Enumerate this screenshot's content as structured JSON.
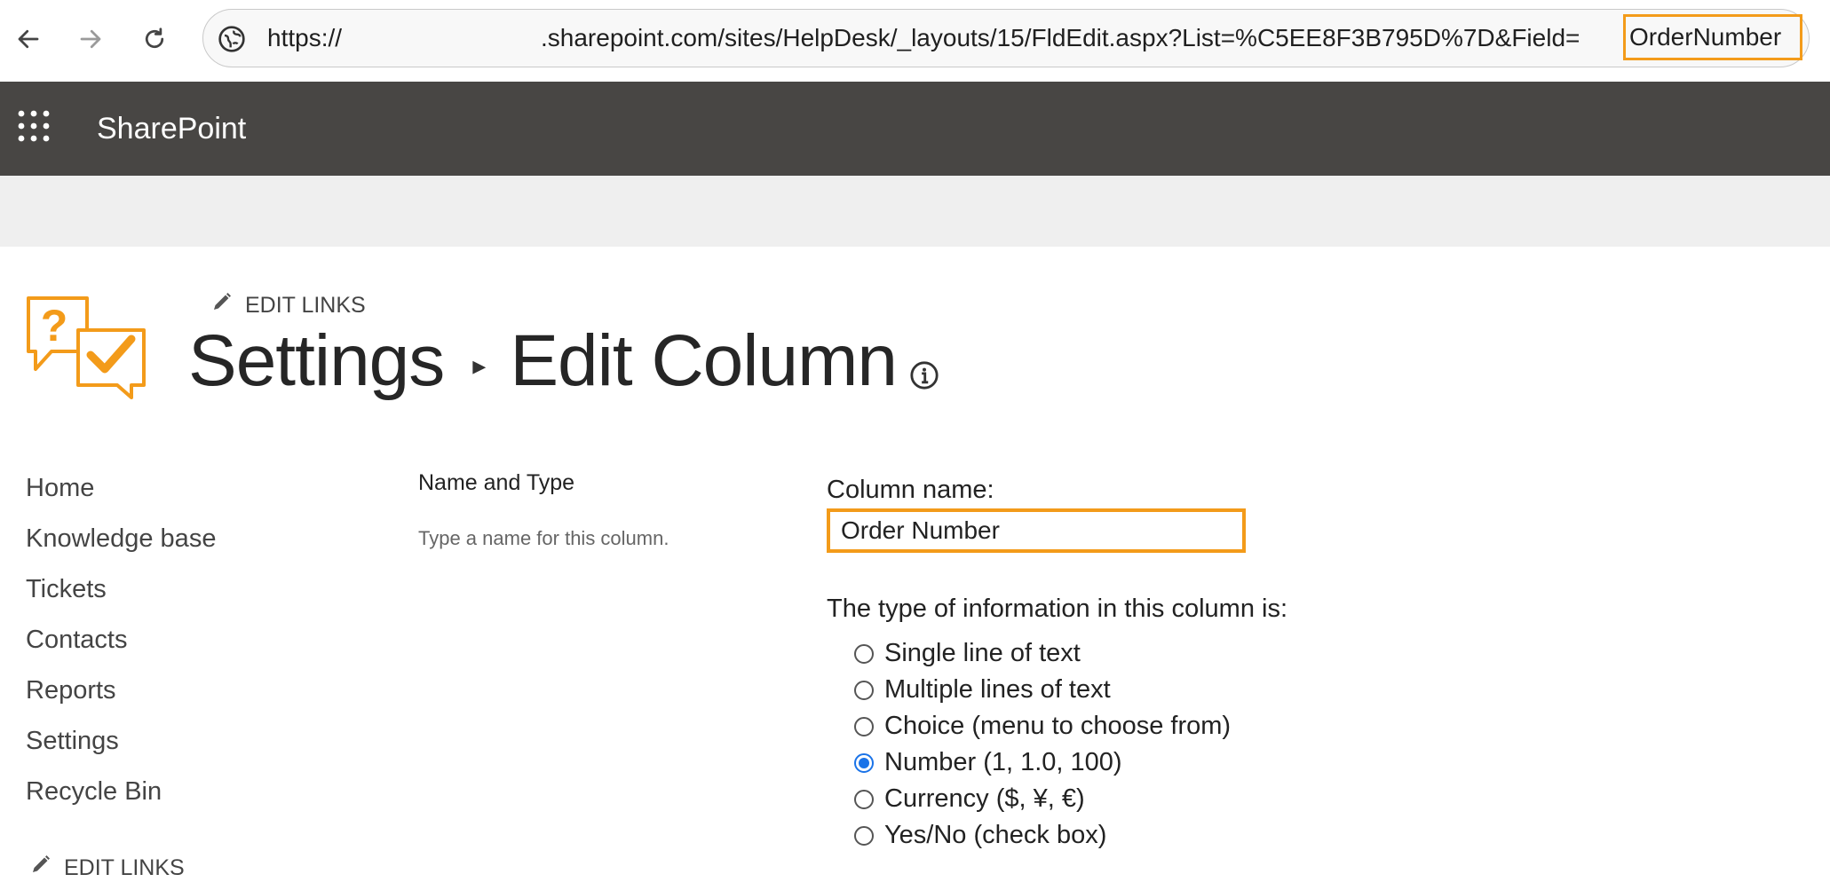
{
  "browser": {
    "url_scheme": "https://",
    "url_path": ".sharepoint.com/sites/HelpDesk/_layouts/15/FldEdit.aspx?List=%C5EE8F3B795D%7D&Field=",
    "url_field_value": "OrderNumber"
  },
  "suite": {
    "brand": "SharePoint"
  },
  "header": {
    "edit_links": "EDIT LINKS",
    "title_parent": "Settings",
    "title_current": "Edit Column"
  },
  "nav": {
    "items": [
      "Home",
      "Knowledge base",
      "Tickets",
      "Contacts",
      "Reports",
      "Settings",
      "Recycle Bin"
    ],
    "edit_links": "EDIT LINKS"
  },
  "section": {
    "title": "Name and Type",
    "description": "Type a name for this column."
  },
  "form": {
    "column_name_label": "Column name:",
    "column_name_value": "Order Number",
    "type_label": "The type of information in this column is:",
    "type_options": [
      "Single line of text",
      "Multiple lines of text",
      "Choice (menu to choose from)",
      "Number (1, 1.0, 100)",
      "Currency ($, ¥, €)",
      "Yes/No (check box)"
    ],
    "selected_option": "Number (1, 1.0, 100)"
  },
  "colors": {
    "accent": "#f39b1a",
    "suite_bar": "#484644",
    "radio_selected": "#1a73e8"
  }
}
